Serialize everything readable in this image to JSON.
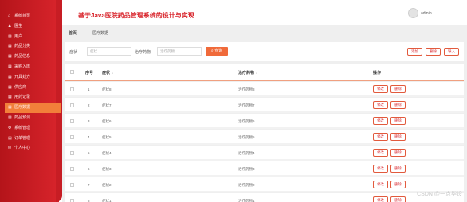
{
  "sidebar": {
    "items": [
      {
        "label": "系统首页",
        "icon": "home-icon",
        "glyph": "⌂"
      },
      {
        "label": "医生",
        "icon": "user-icon",
        "glyph": "♟"
      },
      {
        "label": "用户",
        "icon": "grid-icon",
        "glyph": "▦"
      },
      {
        "label": "药品分类",
        "icon": "grid-icon",
        "glyph": "▦"
      },
      {
        "label": "药品信息",
        "icon": "grid-icon",
        "glyph": "▦"
      },
      {
        "label": "采购入库",
        "icon": "grid-icon",
        "glyph": "▦"
      },
      {
        "label": "开具处方",
        "icon": "grid-icon",
        "glyph": "▦"
      },
      {
        "label": "供应商",
        "icon": "grid-icon",
        "glyph": "▦"
      },
      {
        "label": "用药记录",
        "icon": "grid-icon",
        "glyph": "▦"
      },
      {
        "label": "医疗数据",
        "icon": "grid-icon",
        "glyph": "▦"
      },
      {
        "label": "药品预测",
        "icon": "grid-icon",
        "glyph": "▦"
      },
      {
        "label": "系统管理",
        "icon": "settings-icon",
        "glyph": "⚙"
      },
      {
        "label": "订单管理",
        "icon": "order-icon",
        "glyph": "▤"
      },
      {
        "label": "个人中心",
        "icon": "profile-icon",
        "glyph": "✉"
      }
    ],
    "active_index": 9
  },
  "header": {
    "title": "基于Java医院药品管理系统的设计与实现",
    "username": "admin"
  },
  "breadcrumb": {
    "home": "首页",
    "current": "医疗数据"
  },
  "filter": {
    "symptom_label": "症状",
    "symptom_placeholder": "症状",
    "drug_label": "治疗药物",
    "drug_placeholder": "治疗药物",
    "search_label": "查询",
    "add_label": "添加",
    "delete_label": "删除",
    "import_label": "导入"
  },
  "table": {
    "headers": {
      "index": "序号",
      "symptom": "症状",
      "drug": "治疗药物",
      "actions": "操作"
    },
    "edit_label": "修改",
    "delete_label": "删除",
    "rows": [
      {
        "index": "1",
        "symptom": "症状8",
        "drug": "治疗药物8"
      },
      {
        "index": "2",
        "symptom": "症状7",
        "drug": "治疗药物7"
      },
      {
        "index": "3",
        "symptom": "症状6",
        "drug": "治疗药物6"
      },
      {
        "index": "4",
        "symptom": "症状5",
        "drug": "治疗药物5"
      },
      {
        "index": "5",
        "symptom": "症状4",
        "drug": "治疗药物4"
      },
      {
        "index": "6",
        "symptom": "症状3",
        "drug": "治疗药物3"
      },
      {
        "index": "7",
        "symptom": "症状2",
        "drug": "治疗药物2"
      },
      {
        "index": "8",
        "symptom": "症状1",
        "drug": "治疗药物1"
      }
    ]
  },
  "watermark": "CSDN @一点毕设",
  "colors": {
    "accent": "#d8242b",
    "active": "#f27f3a",
    "search": "#f06a3a"
  }
}
